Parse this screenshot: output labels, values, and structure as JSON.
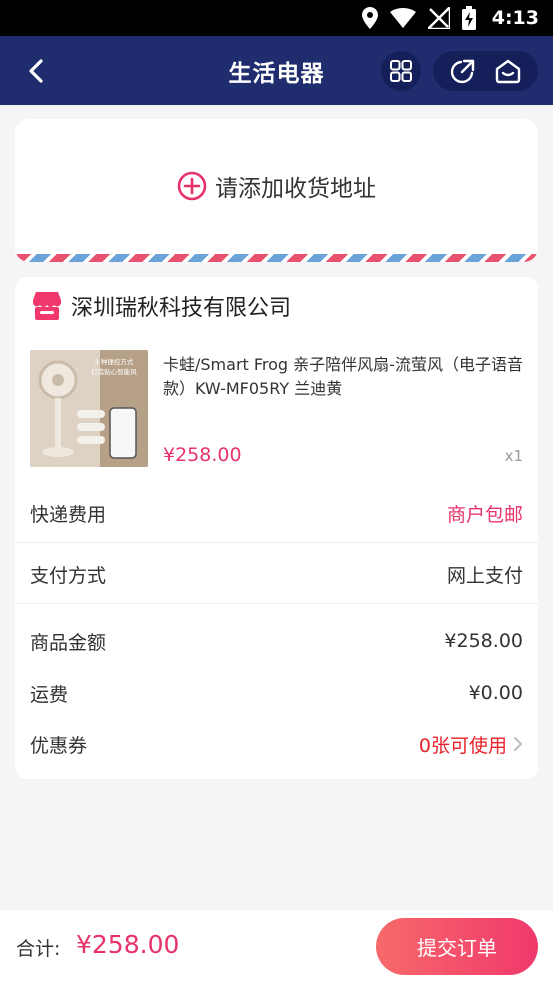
{
  "status_bar": {
    "time": "4:13"
  },
  "header": {
    "title": "生活电器",
    "back_icon": "chevron-left-icon",
    "grid_icon": "grid-icon",
    "share_icon": "share-icon",
    "home_icon": "home-icon"
  },
  "address": {
    "label": "请添加收货地址",
    "icon": "plus-circle-icon"
  },
  "shop": {
    "name": "深圳瑞秋科技有限公司",
    "icon": "store-icon"
  },
  "product": {
    "title": "卡蛙/Smart Frog 亲子陪伴风扇-流萤风（电子语音款）KW-MF05RY 兰迪黄",
    "price": "¥258.00",
    "quantity": "x1",
    "thumb_caption_1": "3 种操控方式",
    "thumb_caption_2": "打造贴心智能风"
  },
  "rows": {
    "shipping": {
      "label": "快递费用",
      "value": "商户包邮"
    },
    "payment": {
      "label": "支付方式",
      "value": "网上支付"
    },
    "goods_amount": {
      "label": "商品金额",
      "value": "¥258.00"
    },
    "freight": {
      "label": "运费",
      "value": "¥0.00"
    },
    "coupon": {
      "label": "优惠券",
      "value": "0张可使用"
    }
  },
  "footer": {
    "total_label": "合计:",
    "total_value": "¥258.00",
    "submit_label": "提交订单"
  },
  "colors": {
    "header_bg": "#1f2d6e",
    "accent_pink": "#e8336a",
    "coupon_red": "#e8222a",
    "submit_gradient_start": "#f76a6a",
    "submit_gradient_end": "#f0386c"
  }
}
